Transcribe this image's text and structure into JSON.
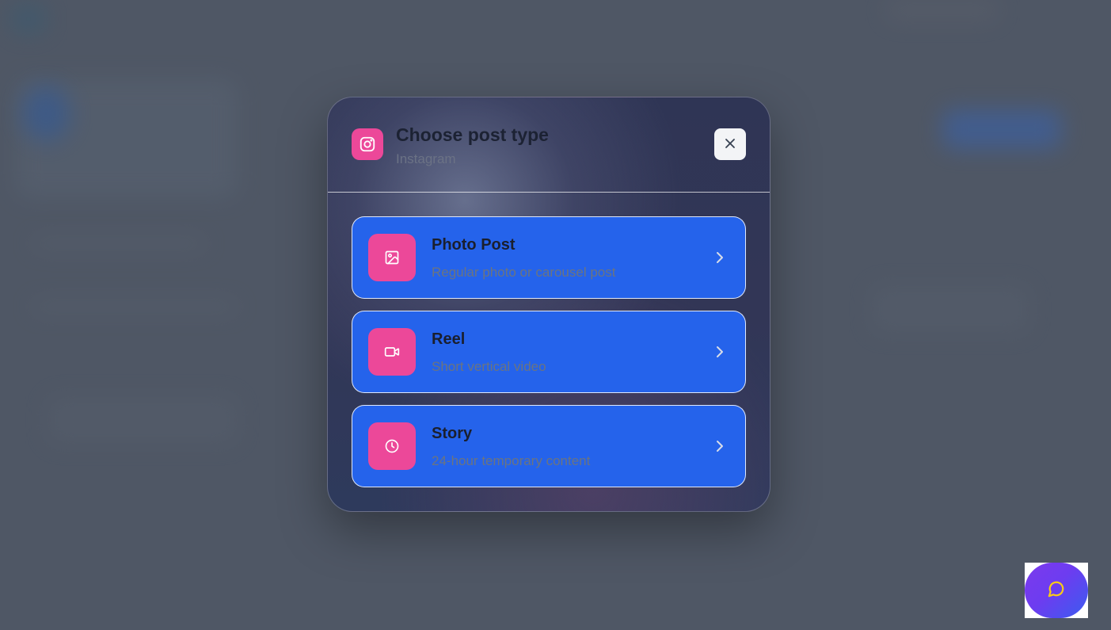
{
  "modal": {
    "title": "Choose post type",
    "subtitle": "Instagram",
    "close_label": "Close"
  },
  "options": [
    {
      "title": "Photo Post",
      "description": "Regular photo or carousel post",
      "icon": "image-icon"
    },
    {
      "title": "Reel",
      "description": "Short vertical video",
      "icon": "video-icon"
    },
    {
      "title": "Story",
      "description": "24-hour temporary content",
      "icon": "clock-icon"
    }
  ],
  "colors": {
    "option_background": "#2563eb",
    "icon_background": "#ec4899",
    "chat_gradient_start": "#7c3aed",
    "chat_gradient_end": "#3b5cf0",
    "chat_icon": "#facc15"
  },
  "chat_button": {
    "icon": "chat-bubble-icon"
  }
}
